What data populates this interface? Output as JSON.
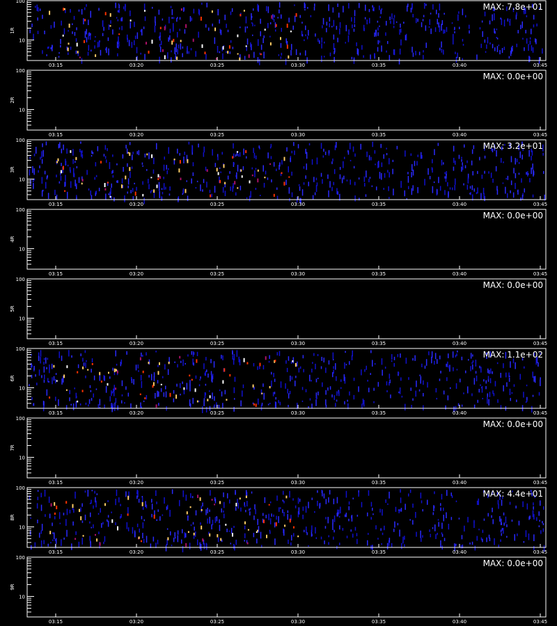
{
  "chart_data": {
    "type": "heatmap",
    "colors": {
      "background": "#000000",
      "axes": "#ffffff",
      "low": "#1a1aff",
      "mid": "#ff3300",
      "high": "#ffffff"
    },
    "x_tick_labels": [
      "03:15",
      "03:20",
      "03:25",
      "03:30",
      "03:35",
      "03:40",
      "03:45"
    ],
    "y_tick_labels": [
      "100",
      "10"
    ],
    "panels": [
      {
        "label": "1R",
        "max_label": "MAX: 7.8e+01",
        "active": true
      },
      {
        "label": "2R",
        "max_label": "MAX: 0.0e+00",
        "active": false
      },
      {
        "label": "3R",
        "max_label": "MAX: 3.2e+01",
        "active": true
      },
      {
        "label": "4R",
        "max_label": "MAX: 0.0e+00",
        "active": false
      },
      {
        "label": "5R",
        "max_label": "MAX: 0.0e+00",
        "active": false
      },
      {
        "label": "6R",
        "max_label": "MAX: 1.1e+02",
        "active": true
      },
      {
        "label": "7R",
        "max_label": "MAX: 0.0e+00",
        "active": false
      },
      {
        "label": "8R",
        "max_label": "MAX: 4.4e+01",
        "active": true
      },
      {
        "label": "9R",
        "max_label": "MAX: 0.0e+00",
        "active": false
      }
    ]
  }
}
